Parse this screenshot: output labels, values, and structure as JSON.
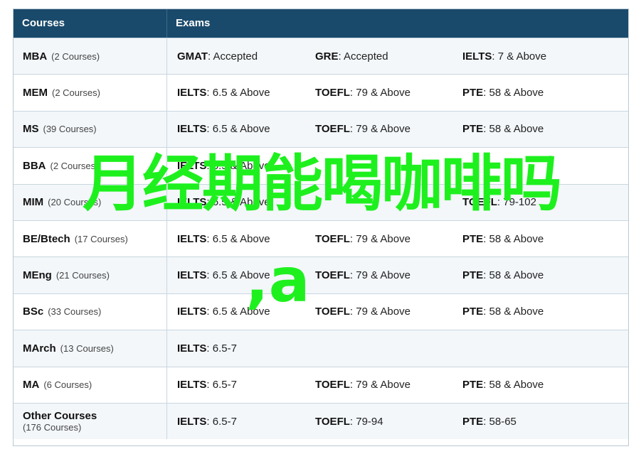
{
  "header": {
    "courses": "Courses",
    "exams": "Exams"
  },
  "rows": [
    {
      "name": "MBA",
      "count": "(2 Courses)",
      "exams": [
        {
          "name": "GMAT",
          "value": ": Accepted"
        },
        {
          "name": "GRE",
          "value": ": Accepted"
        },
        {
          "name": "IELTS",
          "value": ": 7 & Above"
        }
      ]
    },
    {
      "name": "MEM",
      "count": "(2 Courses)",
      "exams": [
        {
          "name": "IELTS",
          "value": ": 6.5 & Above"
        },
        {
          "name": "TOEFL",
          "value": ": 79 & Above"
        },
        {
          "name": "PTE",
          "value": ": 58 & Above"
        }
      ]
    },
    {
      "name": "MS",
      "count": "(39 Courses)",
      "exams": [
        {
          "name": "IELTS",
          "value": ": 6.5 & Above"
        },
        {
          "name": "TOEFL",
          "value": ": 79 & Above"
        },
        {
          "name": "PTE",
          "value": ": 58 & Above"
        }
      ]
    },
    {
      "name": "BBA",
      "count": "(2 Courses)",
      "exams": [
        {
          "name": "IELTS",
          "value": ": 6.5 & Above"
        },
        {
          "name": "",
          "value": ""
        },
        {
          "name": "",
          "value": ""
        }
      ]
    },
    {
      "name": "MIM",
      "count": "(20 Courses)",
      "exams": [
        {
          "name": "IELTS",
          "value": ": 6.5 & Above"
        },
        {
          "name": "",
          "value": ""
        },
        {
          "name": "TOEFL",
          "value": ": 79-102"
        }
      ]
    },
    {
      "name": "BE/Btech",
      "count": "(17 Courses)",
      "exams": [
        {
          "name": "IELTS",
          "value": ": 6.5 & Above"
        },
        {
          "name": "TOEFL",
          "value": ": 79 & Above"
        },
        {
          "name": "PTE",
          "value": ": 58 & Above"
        }
      ]
    },
    {
      "name": "MEng",
      "count": "(21 Courses)",
      "exams": [
        {
          "name": "IELTS",
          "value": ": 6.5 & Above"
        },
        {
          "name": "TOEFL",
          "value": ": 79 & Above"
        },
        {
          "name": "PTE",
          "value": ": 58 & Above"
        }
      ]
    },
    {
      "name": "BSc",
      "count": "(33 Courses)",
      "exams": [
        {
          "name": "IELTS",
          "value": ": 6.5 & Above"
        },
        {
          "name": "TOEFL",
          "value": ": 79 & Above"
        },
        {
          "name": "PTE",
          "value": ": 58 & Above"
        }
      ]
    },
    {
      "name": "MArch",
      "count": "(13 Courses)",
      "exams": [
        {
          "name": "IELTS",
          "value": ": 6.5-7"
        },
        {
          "name": "",
          "value": ""
        },
        {
          "name": "",
          "value": ""
        }
      ]
    },
    {
      "name": "MA",
      "count": "(6 Courses)",
      "exams": [
        {
          "name": "IELTS",
          "value": ": 6.5-7"
        },
        {
          "name": "TOEFL",
          "value": ": 79 & Above"
        },
        {
          "name": "PTE",
          "value": ": 58 & Above"
        }
      ]
    },
    {
      "name": "Other Courses",
      "count": "(176 Courses)",
      "exams": [
        {
          "name": "IELTS",
          "value": ": 6.5-7"
        },
        {
          "name": "TOEFL",
          "value": ": 79-94"
        },
        {
          "name": "PTE",
          "value": ": 58-65"
        }
      ]
    }
  ],
  "overlay": {
    "line1": "月经期能喝咖啡吗",
    "line2": ",a"
  },
  "colors": {
    "header_bg": "#1a4a6b",
    "overlay": "#1ef01e"
  }
}
